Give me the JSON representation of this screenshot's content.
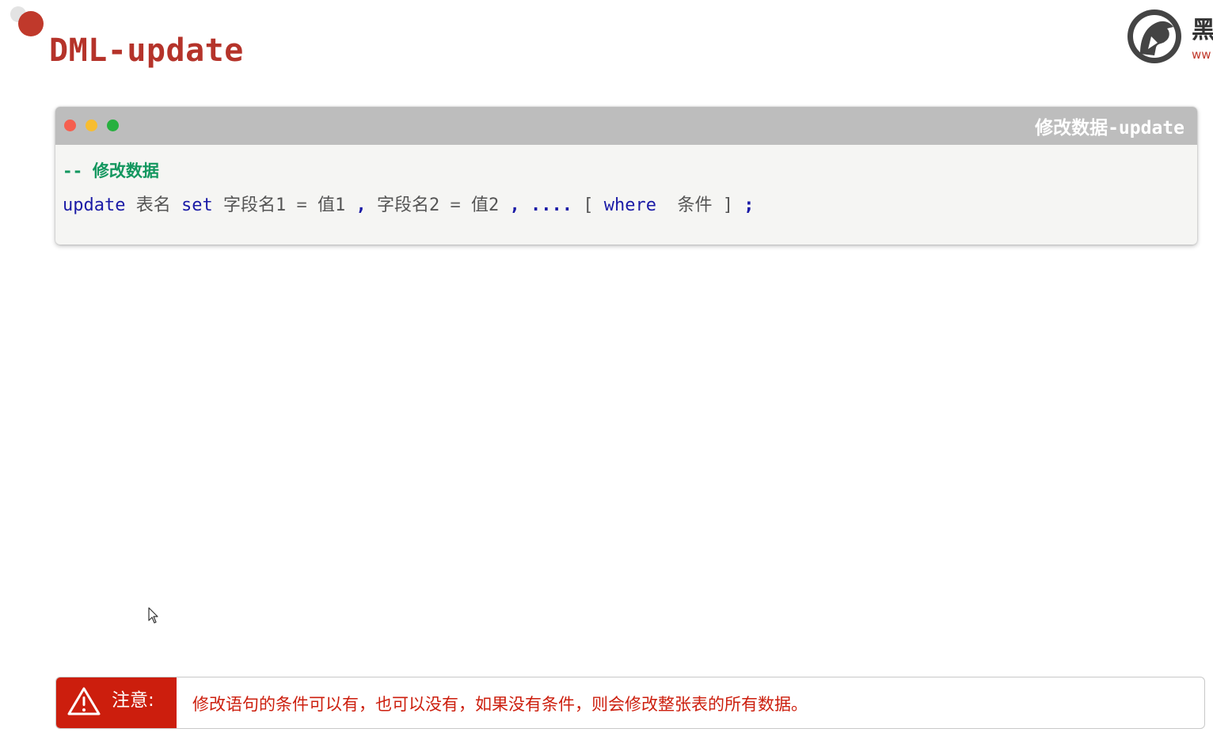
{
  "slide": {
    "title": "DML-update"
  },
  "logo": {
    "text": "黑",
    "subtext": "ww",
    "icon": "horse-head-logo-icon"
  },
  "code_window": {
    "title": "修改数据-update",
    "traffic_lights": [
      "close",
      "minimize",
      "maximize"
    ],
    "comment": "-- 修改数据",
    "statement": {
      "kw_update": "update",
      "table": "表名",
      "kw_set": "set",
      "field1": "字段名1",
      "eq1": "=",
      "value1": "值1",
      "comma1": ",",
      "field2": "字段名2",
      "eq2": "=",
      "value2": "值2",
      "comma2": ",",
      "ellipsis": "....",
      "open_bracket": "[",
      "kw_where": "where",
      "condition": "条件",
      "close_bracket": "]",
      "semicolon": ";"
    }
  },
  "note": {
    "icon": "warning-icon",
    "label": "注意:",
    "text": "修改语句的条件可以有，也可以没有，如果没有条件，则会修改整张表的所有数据。"
  },
  "colors": {
    "accent": "#c0392b",
    "keyword": "#1a1aa6",
    "comment": "#13975f",
    "note_red": "#cc1e0d",
    "window_titlebar": "#bdbdbd"
  }
}
